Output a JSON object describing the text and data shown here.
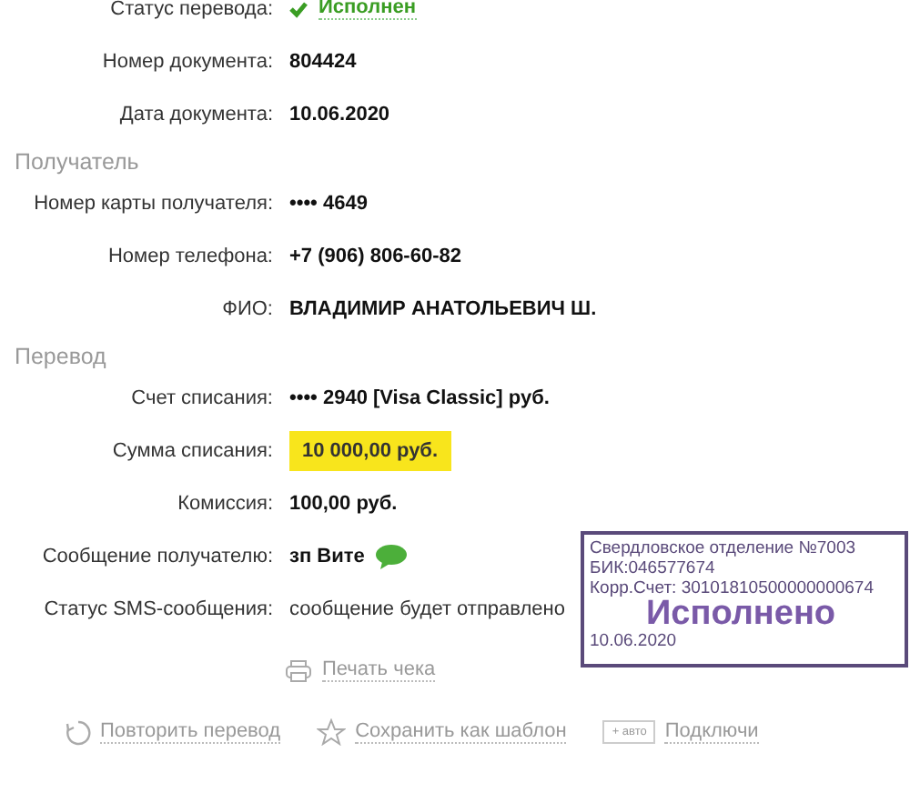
{
  "top_rows": [
    {
      "label": "Статус перевода:",
      "value": "Исполнен",
      "kind": "status"
    },
    {
      "label": "Номер документа:",
      "value": "804424",
      "kind": "bold"
    },
    {
      "label": "Дата документа:",
      "value": "10.06.2020",
      "kind": "bold"
    }
  ],
  "sections": [
    {
      "title": "Получатель",
      "rows": [
        {
          "label": "Номер карты получателя:",
          "value": "•••• 4649",
          "kind": "bold"
        },
        {
          "label": "Номер телефона:",
          "value": "+7 (906) 806-60-82",
          "kind": "bold"
        },
        {
          "label": "ФИО:",
          "value": "ВЛАДИМИР АНАТОЛЬЕВИЧ Ш.",
          "kind": "bold"
        }
      ]
    },
    {
      "title": "Перевод",
      "rows": [
        {
          "label": "Счет списания:",
          "value": "•••• 2940  [Visa Classic]  руб.",
          "kind": "bold"
        },
        {
          "label": "Сумма списания:",
          "value": "10 000,00  руб.",
          "kind": "highlight"
        },
        {
          "label": "Комиссия:",
          "value": "100,00 руб.",
          "kind": "bold"
        },
        {
          "label": "Сообщение получателю:",
          "value": "зп Вите",
          "kind": "message"
        },
        {
          "label": "Статус SMS-сообщения:",
          "value": "сообщение будет отправлено",
          "kind": "light"
        }
      ]
    }
  ],
  "stamp": {
    "lines": [
      "Свердловское отделение №7003",
      "БИК:046577674",
      "Корр.Счет: 30101810500000000674"
    ],
    "mark": "Исполнено",
    "date": "10.06.2020"
  },
  "print_link": "Печать чека",
  "actions": [
    {
      "kind": "repeat",
      "label": "Повторить перевод"
    },
    {
      "kind": "star",
      "label": "Сохранить как шаблон"
    },
    {
      "kind": "auto",
      "badge": "+ авто",
      "label": "Подключи"
    }
  ]
}
